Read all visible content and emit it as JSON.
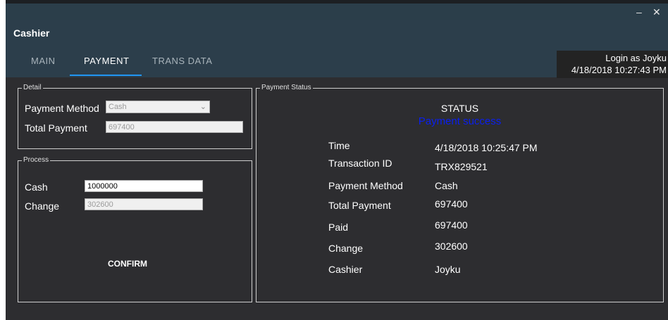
{
  "window": {
    "minimize_glyph": "–",
    "close_glyph": "✕"
  },
  "app": {
    "title": "Cashier"
  },
  "tabs": [
    {
      "label": "MAIN",
      "active": false
    },
    {
      "label": "PAYMENT",
      "active": true
    },
    {
      "label": "TRANS DATA",
      "active": false
    }
  ],
  "session": {
    "login_text": "Login as Joyku",
    "datetime": "4/18/2018 10:27:43 PM"
  },
  "detail": {
    "legend": "Detail",
    "payment_method_label": "Payment Method",
    "payment_method_value": "Cash",
    "total_payment_label": "Total Payment",
    "total_payment_value": "697400"
  },
  "process": {
    "legend": "Process",
    "cash_label": "Cash",
    "cash_value": "1000000",
    "change_label": "Change",
    "change_value": "302600",
    "confirm_label": "CONFIRM"
  },
  "payment_status": {
    "legend": "Payment Status",
    "title": "STATUS",
    "message": "Payment success",
    "rows": [
      {
        "label": "Time",
        "value": "4/18/2018 10:25:47 PM"
      },
      {
        "label": "Transaction ID",
        "value": "TRX829521"
      },
      {
        "label": "Payment Method",
        "value": "Cash"
      },
      {
        "label": "Total Payment",
        "value": "697400"
      },
      {
        "label": "Paid",
        "value": "697400"
      },
      {
        "label": "Change",
        "value": "302600"
      },
      {
        "label": "Cashier",
        "value": "Joyku"
      }
    ]
  },
  "colors": {
    "header_bg": "#2c3e4b",
    "body_bg": "#2d2d30",
    "accent": "#2196f3",
    "status_success": "#0a1ff0"
  }
}
